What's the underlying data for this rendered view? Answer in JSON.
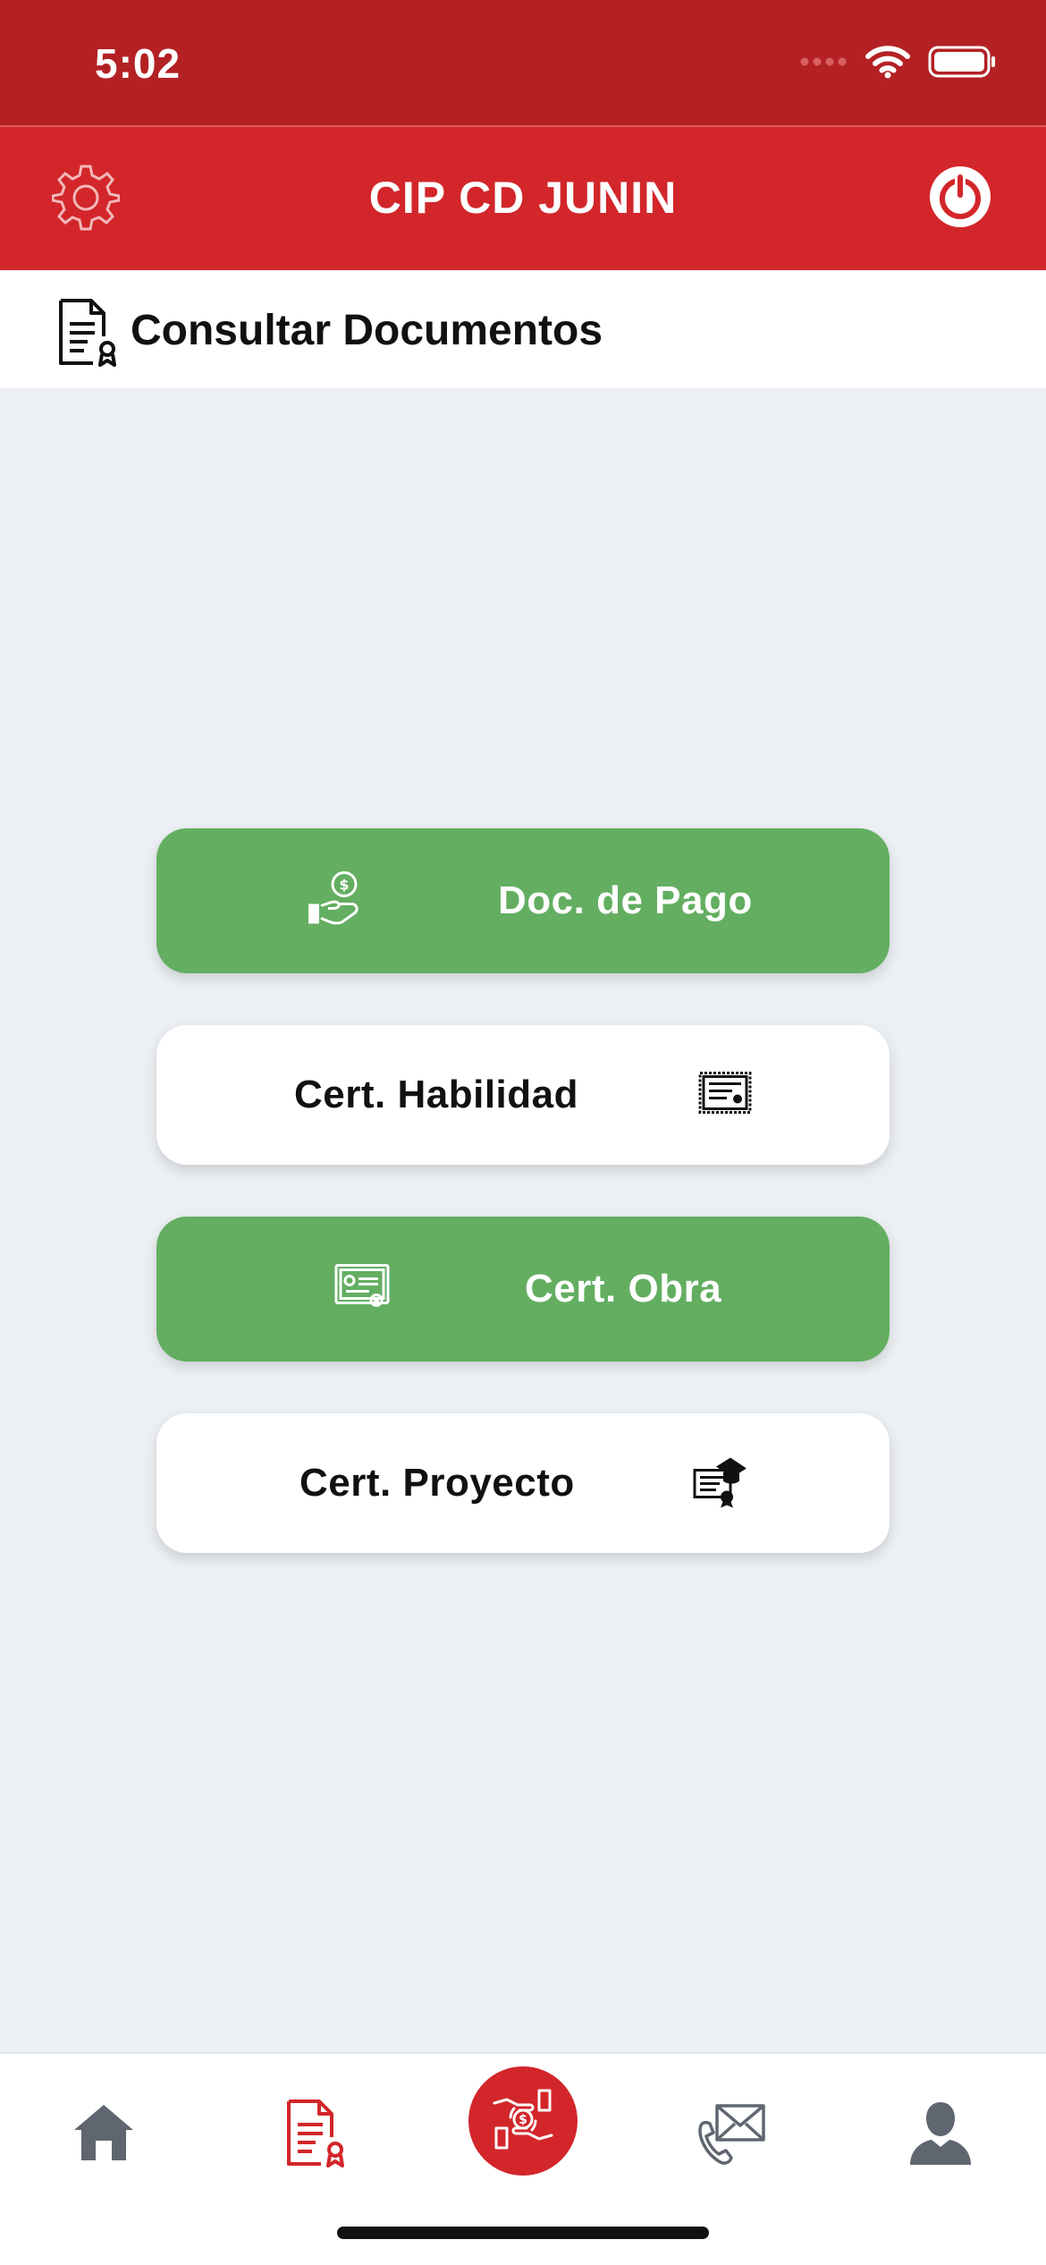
{
  "status_bar": {
    "time": "5:02"
  },
  "header": {
    "title": "CIP CD JUNIN",
    "settings_icon": "gear-icon",
    "power_icon": "power-icon"
  },
  "page": {
    "title": "Consultar Documentos",
    "icon": "document-certificate-icon"
  },
  "menu": {
    "items": [
      {
        "label": "Doc. de Pago",
        "style": "green",
        "icon": "hand-money-icon"
      },
      {
        "label": "Cert. Habilidad",
        "style": "white",
        "icon": "certificate-icon"
      },
      {
        "label": "Cert. Obra",
        "style": "green",
        "icon": "diploma-icon"
      },
      {
        "label": "Cert. Proyecto",
        "style": "white",
        "icon": "graduation-document-icon"
      }
    ]
  },
  "bottom_nav": {
    "items": [
      {
        "icon": "home-icon",
        "active": false
      },
      {
        "icon": "document-icon",
        "active": true
      },
      {
        "icon": "payment-exchange-icon",
        "active": false,
        "center": true
      },
      {
        "icon": "contact-mail-phone-icon",
        "active": false
      },
      {
        "icon": "user-icon",
        "active": false
      }
    ]
  },
  "colors": {
    "primary_red": "#D2262A",
    "status_red": "#B32124",
    "green": "#63AE61",
    "background": "#ECEFF3",
    "nav_gray": "#5F6670"
  }
}
